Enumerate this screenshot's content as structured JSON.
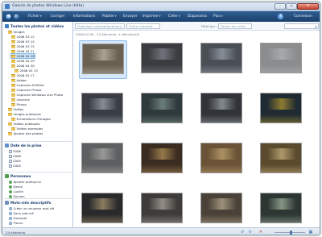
{
  "window": {
    "title": "Galerie de photos Windows Live (bêta)",
    "buttons": {
      "minimize": "–",
      "maximize": "▭",
      "close": "✕"
    }
  },
  "toolbar": {
    "back": "◀",
    "forward": "▶",
    "menus": [
      {
        "label": "Fichier",
        "arrow": "▾"
      },
      {
        "label": "Corriger",
        "arrow": ""
      },
      {
        "label": "Informations",
        "arrow": ""
      },
      {
        "label": "Publier",
        "arrow": "▾"
      },
      {
        "label": "Envoyer",
        "arrow": ""
      },
      {
        "label": "Imprimer",
        "arrow": "▾"
      },
      {
        "label": "Créer",
        "arrow": "▾"
      },
      {
        "label": "Diaporama",
        "arrow": ""
      },
      {
        "label": "Plus",
        "arrow": "▾"
      }
    ],
    "help": "?",
    "connect": "Connexion"
  },
  "filterbar": {
    "sort": "Organiser automatiquement",
    "order": "Ordre croissant",
    "filter_label": "Filtré par :",
    "filter_value": "Toutes les notes",
    "search_icon": "⚲"
  },
  "content": {
    "breadcrumb": "2006.04.28 - 24 éléments, 1 sélectionné"
  },
  "sidebar": {
    "all_photos": "Toutes les photos et vidéos",
    "tree": [
      {
        "label": "Images",
        "indent": 1,
        "icon": "folder"
      },
      {
        "label": "2006 03 12",
        "indent": 2,
        "icon": "folder"
      },
      {
        "label": "2006 03 14",
        "indent": 2,
        "icon": "folder"
      },
      {
        "label": "2006 03 15",
        "indent": 2,
        "icon": "folder"
      },
      {
        "label": "2006 04 21",
        "indent": 2,
        "icon": "folder"
      },
      {
        "label": "2006 04 28",
        "indent": 2,
        "icon": "folder",
        "selected": true
      },
      {
        "label": "2006 04 29",
        "indent": 2,
        "icon": "folder"
      },
      {
        "label": "2006 04 30",
        "indent": 2,
        "icon": "folder"
      },
      {
        "label": "2006 05 13",
        "indent": 3,
        "icon": "folder"
      },
      {
        "label": "2006 05 17",
        "indent": 2,
        "icon": "folder"
      },
      {
        "label": "Adobe",
        "indent": 2,
        "icon": "folder"
      },
      {
        "label": "Captures ACDSee",
        "indent": 2,
        "icon": "folder"
      },
      {
        "label": "Captures Picasa",
        "indent": 2,
        "icon": "folder"
      },
      {
        "label": "Captures Windows Live Photo",
        "indent": 2,
        "icon": "folder"
      },
      {
        "label": "Lecanne",
        "indent": 2,
        "icon": "folder"
      },
      {
        "label": "Picasa",
        "indent": 2,
        "icon": "folder"
      },
      {
        "label": "Vidéos",
        "indent": 1,
        "icon": "folder"
      },
      {
        "label": "Images publiques",
        "indent": 1,
        "icon": "folder"
      },
      {
        "label": "Echantillons d'images",
        "indent": 2,
        "icon": "folder"
      },
      {
        "label": "Vidéos publiques",
        "indent": 1,
        "icon": "folder"
      },
      {
        "label": "Vidéos exemples",
        "indent": 2,
        "icon": "folder"
      },
      {
        "label": "Ajouter des photos",
        "indent": 1,
        "icon": "folder"
      }
    ],
    "date_section": "Date de la prise",
    "years": [
      "2008",
      "2006",
      "2005",
      "2004"
    ],
    "people_section": "Personnes",
    "people": [
      "Ajouter quelqu'un",
      "Demo",
      "Lucille",
      "Sylvain"
    ],
    "tags_section": "Mots-clés descriptifs",
    "tags": [
      "Créer un nouveau mot-clé",
      "Sans mot-clé",
      "Exemple",
      "Fleurs"
    ]
  },
  "status": {
    "count": "24 éléments",
    "rotate_left": "↺",
    "rotate_right": "↻",
    "delete": "✕",
    "zoom_level": 0.55,
    "grid_icon": "▦"
  },
  "photos": [
    {
      "name": "photo-01",
      "bg": "#6a6052",
      "accent": "#ddd7c8",
      "selected": true
    },
    {
      "name": "photo-02",
      "bg": "#3b3c40",
      "accent": "#9aa0a8"
    },
    {
      "name": "photo-03",
      "bg": "#4a4f56",
      "accent": "#b9c2cc"
    },
    {
      "name": "photo-04",
      "bg": "#8a8c8e",
      "accent": "#bfc1c3"
    },
    {
      "name": "photo-05",
      "bg": "#3a3e44",
      "accent": "#c6ced8"
    },
    {
      "name": "photo-06",
      "bg": "#2f3a3d",
      "accent": "#9bb4a8"
    },
    {
      "name": "photo-07",
      "bg": "#303338",
      "accent": "#c9d0d8"
    },
    {
      "name": "photo-08",
      "bg": "#1f2a33",
      "accent": "#e3c02a"
    },
    {
      "name": "photo-09",
      "bg": "#5e5f60",
      "accent": "#c8c8c8"
    },
    {
      "name": "photo-10",
      "bg": "#3b2c22",
      "accent": "#e0b86a"
    },
    {
      "name": "photo-11",
      "bg": "#6a5336",
      "accent": "#e2c58a"
    },
    {
      "name": "photo-12",
      "bg": "#5a4a2e",
      "accent": "#f0d89a"
    },
    {
      "name": "photo-13",
      "bg": "#2a2a2c",
      "accent": "#d8c08a"
    },
    {
      "name": "photo-14",
      "bg": "#3e3c3a",
      "accent": "#d7d0c6"
    },
    {
      "name": "photo-15",
      "bg": "#4a4238",
      "accent": "#e0d2b4"
    },
    {
      "name": "photo-16",
      "bg": "#2c3632",
      "accent": "#cfe0c6"
    }
  ]
}
